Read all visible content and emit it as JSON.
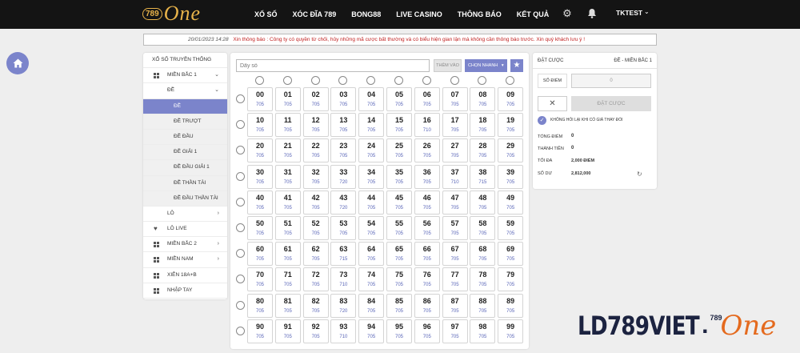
{
  "header": {
    "logo_num": "789",
    "logo_word": "One",
    "nav": [
      "XỔ SỐ",
      "XÓC ĐĨA 789",
      "BONG88",
      "LIVE CASINO",
      "THÔNG BÁO",
      "KẾT QUẢ"
    ],
    "username": "TKTEST"
  },
  "notice": {
    "timestamp": "20/01/2023 14:28",
    "message": "Xin thông báo : Công ty có quyền từ chối, hủy những mã cược bất thường và có biểu hiện gian lận mà không cần thông báo trước. Xin quý khách lưu ý !"
  },
  "sidebar": {
    "title": "XỔ SỐ TRUYỀN THỐNG",
    "items": [
      {
        "label": "MIỀN BẮC 1",
        "icon": "grid",
        "chevron": "down",
        "indent": 0
      },
      {
        "label": "ĐỀ",
        "icon": "",
        "chevron": "down",
        "indent": 1
      },
      {
        "label": "ĐỀ",
        "icon": "",
        "chevron": "",
        "indent": 2,
        "active": true
      },
      {
        "label": "ĐỀ TRƯỢT",
        "icon": "",
        "chevron": "",
        "indent": 2
      },
      {
        "label": "ĐỀ ĐẦU",
        "icon": "",
        "chevron": "",
        "indent": 2
      },
      {
        "label": "ĐỀ GIẢI 1",
        "icon": "",
        "chevron": "",
        "indent": 2
      },
      {
        "label": "ĐỀ ĐẦU GIẢI 1",
        "icon": "",
        "chevron": "",
        "indent": 2
      },
      {
        "label": "ĐỀ THẦN TÀI",
        "icon": "",
        "chevron": "",
        "indent": 2
      },
      {
        "label": "ĐỀ ĐẦU THẦN TÀI",
        "icon": "",
        "chevron": "",
        "indent": 2
      },
      {
        "label": "LÔ",
        "icon": "",
        "chevron": "right",
        "indent": 1
      },
      {
        "label": "LÔ LIVE",
        "icon": "heart",
        "chevron": "",
        "indent": 0
      },
      {
        "label": "MIỀN BẮC 2",
        "icon": "grid",
        "chevron": "right",
        "indent": 0
      },
      {
        "label": "MIỀN NAM",
        "icon": "grid",
        "chevron": "right",
        "indent": 0
      },
      {
        "label": "XIÊN 18A+B",
        "icon": "grid",
        "chevron": "",
        "indent": 0
      },
      {
        "label": "NHẬP TAY",
        "icon": "grid",
        "chevron": "",
        "indent": 0
      }
    ]
  },
  "picker": {
    "input_placeholder": "Dãy số",
    "add_label": "THÊM VÀO",
    "quick_label": "CHỌN NHANH",
    "odds": [
      [
        "705",
        "705",
        "705",
        "705",
        "705",
        "705",
        "705",
        "705",
        "705",
        "705"
      ],
      [
        "705",
        "705",
        "705",
        "705",
        "705",
        "705",
        "710",
        "705",
        "705",
        "705"
      ],
      [
        "705",
        "705",
        "705",
        "705",
        "705",
        "705",
        "705",
        "705",
        "705",
        "705"
      ],
      [
        "705",
        "705",
        "705",
        "720",
        "705",
        "705",
        "705",
        "710",
        "715",
        "705"
      ],
      [
        "705",
        "705",
        "705",
        "720",
        "705",
        "705",
        "705",
        "705",
        "705",
        "705"
      ],
      [
        "705",
        "705",
        "705",
        "705",
        "705",
        "705",
        "705",
        "705",
        "705",
        "705"
      ],
      [
        "705",
        "705",
        "705",
        "715",
        "705",
        "705",
        "705",
        "705",
        "705",
        "705"
      ],
      [
        "705",
        "705",
        "705",
        "710",
        "705",
        "705",
        "705",
        "705",
        "705",
        "705"
      ],
      [
        "705",
        "705",
        "705",
        "720",
        "705",
        "705",
        "705",
        "705",
        "705",
        "705"
      ],
      [
        "705",
        "705",
        "705",
        "710",
        "705",
        "705",
        "705",
        "705",
        "705",
        "705"
      ]
    ]
  },
  "bet": {
    "title": "ĐẶT CƯỢC",
    "game": "ĐỀ - MIỀN BẮC 1",
    "points_label": "SỐ ĐIỂM",
    "points_value": "0",
    "place_label": "ĐẶT CƯỢC",
    "confirm_label": "KHÔNG HỎI LẠI KHI CÓ GIÁ THAY ĐỔI",
    "total_points_label": "TỔNG ĐIỂM",
    "total_points": "0",
    "amount_label": "THÀNH TIỀN",
    "amount": "0",
    "max_label": "TỐI ĐA",
    "max": "2,000 ĐIỂM",
    "balance_label": "SỐ DƯ",
    "balance": "2,812,000"
  },
  "watermark": {
    "text": "LD789VIET",
    "badge": "789",
    "suffix": "One"
  },
  "colors": {
    "accent": "#7b84cb",
    "header_bg": "#141414",
    "gold": "#e8b34a",
    "notice_text": "#c02020",
    "orange": "#e46a1e"
  }
}
